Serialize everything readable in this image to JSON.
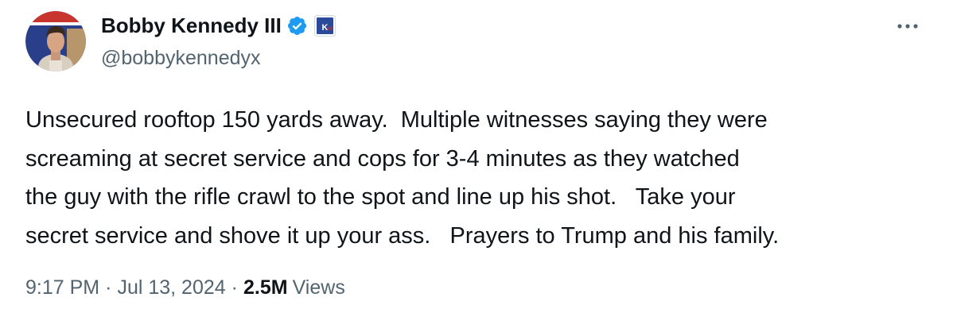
{
  "author": {
    "display_name": "Bobby Kennedy III",
    "handle": "@bobbykennedyx",
    "verified_icon": "verified-badge-icon",
    "verified_color": "#1d9bf0",
    "affiliate_badge_text": "K24",
    "affiliate_badge_color": "#2c4a9a",
    "affiliate_badge_accent": "#d62b2b"
  },
  "tweet": {
    "text": "Unsecured rooftop 150 yards away.  Multiple witnesses saying they were\nscreaming at secret service and cops for 3-4 minutes as they watched\nthe guy with the rifle crawl to the spot and line up his shot.   Take your\nsecret service and shove it up your ass.   Prayers to Trump and his family."
  },
  "meta": {
    "time": "9:17 PM",
    "separator": "·",
    "date": "Jul 13, 2024",
    "views_count": "2.5M",
    "views_label": "Views"
  },
  "more_icon": "more-horizontal-icon"
}
